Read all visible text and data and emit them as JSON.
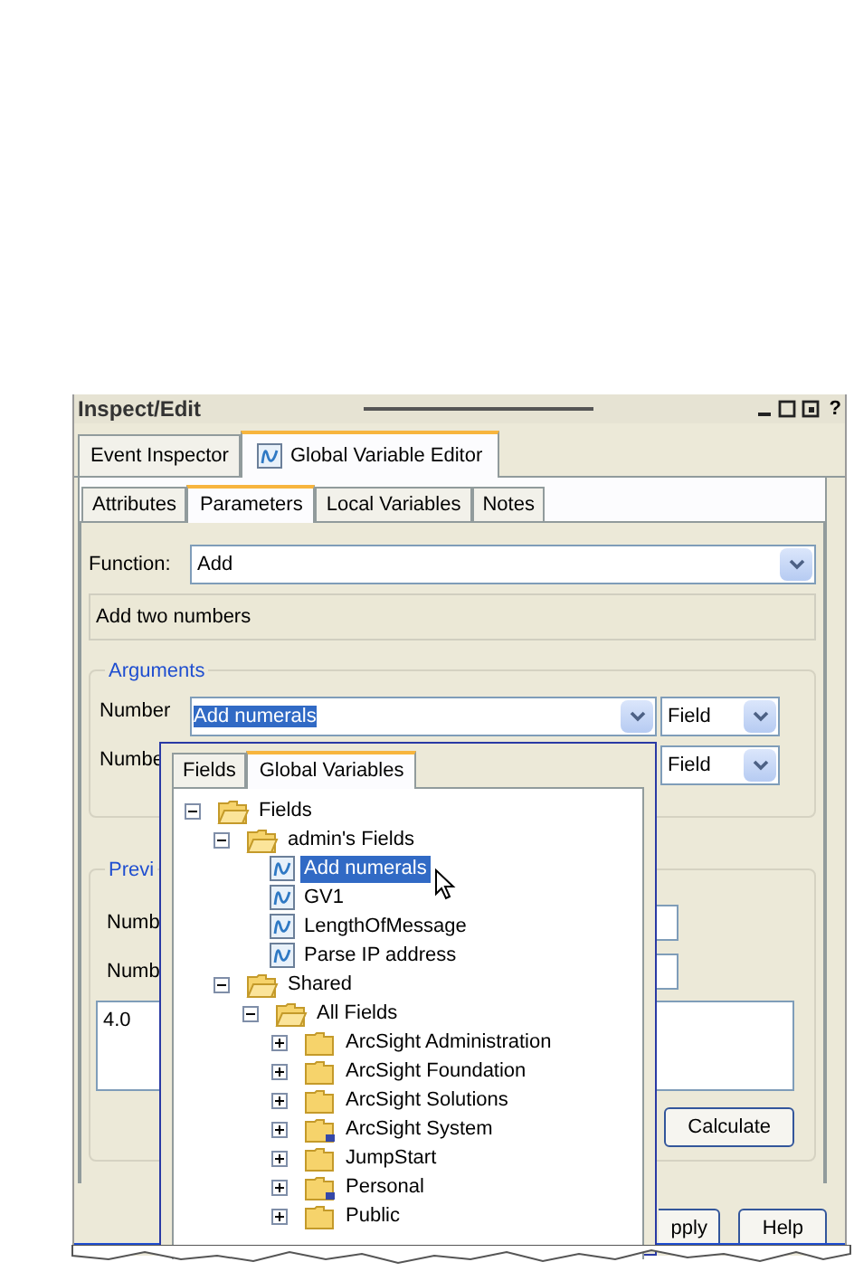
{
  "window": {
    "title": "Inspect/Edit",
    "help_glyph": "?"
  },
  "outer_tabs": [
    {
      "label": "Event Inspector",
      "selected": false,
      "has_icon": false
    },
    {
      "label": "Global Variable Editor",
      "selected": true,
      "has_icon": true
    }
  ],
  "inner_tabs": [
    {
      "label": "Attributes",
      "selected": false
    },
    {
      "label": "Parameters",
      "selected": true
    },
    {
      "label": "Local Variables",
      "selected": false
    },
    {
      "label": "Notes",
      "selected": false
    }
  ],
  "function": {
    "label": "Function:",
    "value": "Add"
  },
  "description": "Add two numbers",
  "arguments": {
    "legend": "Arguments",
    "rows": [
      {
        "label": "Number",
        "value": "Add numerals",
        "highlighted": true,
        "type": "Field"
      },
      {
        "label": "Numbe",
        "type": "Field"
      }
    ]
  },
  "preview": {
    "legend": "Previ",
    "rows": [
      {
        "label": "Numb"
      },
      {
        "label": "Numb"
      }
    ],
    "result": "4.0",
    "calculate": "Calculate"
  },
  "buttons": [
    "pply",
    "Help"
  ],
  "picker": {
    "tabs": [
      {
        "label": "Fields",
        "selected": false
      },
      {
        "label": "Global Variables",
        "selected": true
      }
    ],
    "tree": [
      {
        "label": "Fields",
        "kind": "folder",
        "expanded": true,
        "selected": false,
        "children": [
          {
            "label": "admin's Fields",
            "kind": "folder",
            "expanded": true,
            "selected": false,
            "children": [
              {
                "label": "Add numerals",
                "kind": "variable",
                "selected": true
              },
              {
                "label": "GV1",
                "kind": "variable",
                "selected": false
              },
              {
                "label": "LengthOfMessage",
                "kind": "variable",
                "selected": false
              },
              {
                "label": "Parse IP address",
                "kind": "variable",
                "selected": false
              }
            ]
          },
          {
            "label": "Shared",
            "kind": "folder",
            "expanded": true,
            "selected": false,
            "children": [
              {
                "label": "All Fields",
                "kind": "folder",
                "expanded": true,
                "selected": false,
                "children": [
                  {
                    "label": "ArcSight Administration",
                    "kind": "folder",
                    "expanded": false,
                    "locked": false,
                    "selected": false
                  },
                  {
                    "label": "ArcSight Foundation",
                    "kind": "folder",
                    "expanded": false,
                    "locked": false,
                    "selected": false
                  },
                  {
                    "label": "ArcSight Solutions",
                    "kind": "folder",
                    "expanded": false,
                    "locked": false,
                    "selected": false
                  },
                  {
                    "label": "ArcSight System",
                    "kind": "folder",
                    "expanded": false,
                    "locked": true,
                    "selected": false
                  },
                  {
                    "label": "JumpStart",
                    "kind": "folder",
                    "expanded": false,
                    "locked": false,
                    "selected": false
                  },
                  {
                    "label": "Personal",
                    "kind": "folder",
                    "expanded": false,
                    "locked": true,
                    "selected": false
                  },
                  {
                    "label": "Public",
                    "kind": "folder",
                    "expanded": false,
                    "locked": false,
                    "selected": false
                  }
                ]
              }
            ]
          }
        ]
      }
    ]
  }
}
